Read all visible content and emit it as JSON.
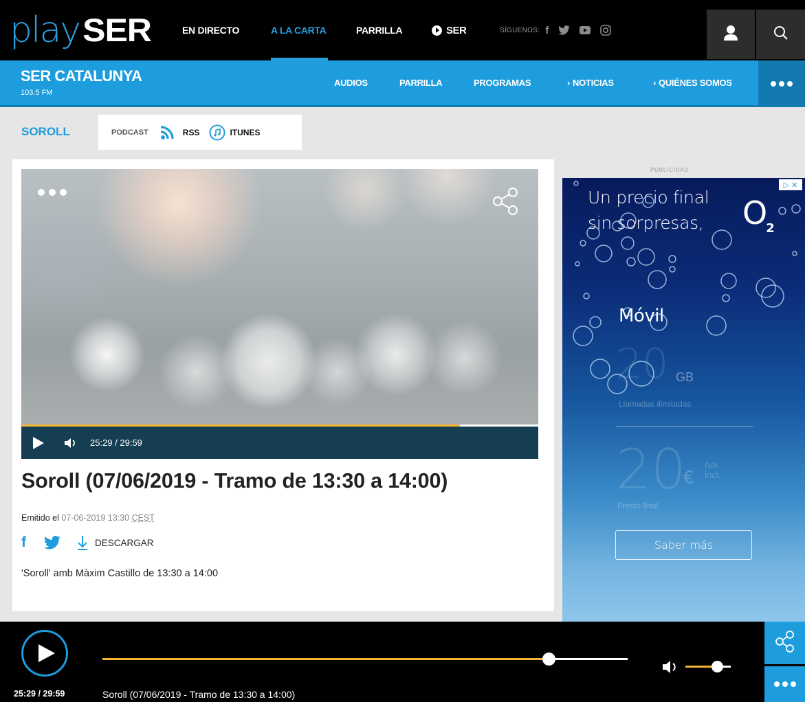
{
  "brand": {
    "play": "play",
    "ser": "SER"
  },
  "topnav": {
    "en_directo": "EN DIRECTO",
    "a_la_carta": "A LA CARTA",
    "parrilla": "PARRILLA",
    "ser": "SER",
    "siguenos": "SÍGUENOS:",
    "social": [
      "facebook-icon",
      "twitter-icon",
      "youtube-icon",
      "instagram-icon"
    ]
  },
  "station": {
    "name": "SER CATALUNYA",
    "freq": "103.5 FM",
    "nav": {
      "audios": "AUDIOS",
      "parrilla": "PARRILLA",
      "programas": "PROGRAMAS",
      "noticias": "NOTICIAS",
      "quienes_somos": "QUIÉNES SOMOS"
    }
  },
  "program": {
    "name": "SOROLL",
    "podcast_label": "PODCAST",
    "rss": "RSS",
    "itunes": "ITUNES"
  },
  "episode": {
    "time": "25:29 / 29:59",
    "progress": 0.849,
    "title": "Soroll (07/06/2019 - Tramo de 13:30 a 14:00)",
    "emitido_label": "Emitido el",
    "date": "07-06-2019 13:30",
    "tz": "CEST",
    "download": "DESCARGAR",
    "description": "'Soroll' amb Màxim Castillo de 13:30 a 14:00"
  },
  "ad": {
    "label": "PUBLICIDAD",
    "line1": "Un precio final",
    "line2": "sin sorpresas,",
    "brand": "O",
    "brand_sub": "2",
    "movil": "Móvil",
    "gb_amount": "20",
    "gb_unit": "GB",
    "llamadas": "Llamadas ilimitadas",
    "price": "20",
    "currency": "€",
    "iva1": "IVA",
    "iva2": "incl.",
    "precio_final": "Precio final",
    "cta": "Saber más"
  },
  "player": {
    "time": "25:29 / 29:59",
    "title": "Soroll (07/06/2019 - Tramo de 13:30 a 14:00)",
    "progress": 0.849,
    "volume": 0.7
  },
  "colors": {
    "accent": "#1d9ddd",
    "progress": "#f4b331",
    "topbar": "#000000",
    "player_controls": "#163e52"
  }
}
